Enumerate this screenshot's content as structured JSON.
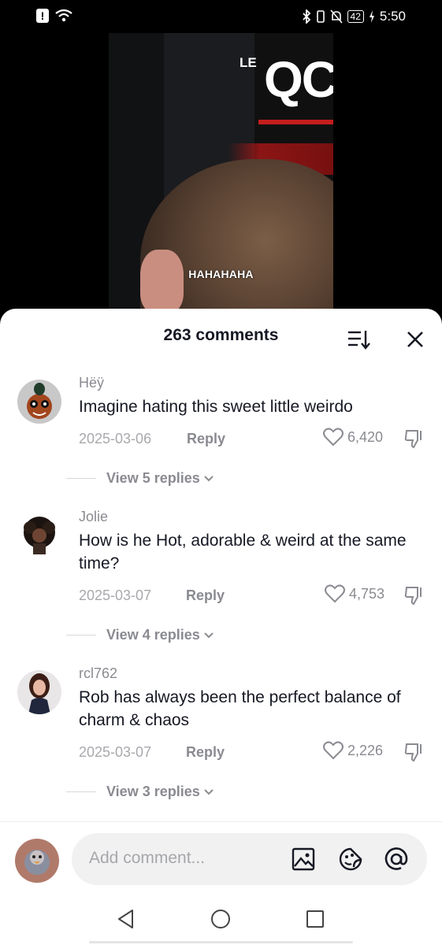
{
  "status_bar": {
    "alert_icon": "!",
    "battery_level": "42",
    "time": "5:50"
  },
  "video": {
    "caption": "HAHAHAHA",
    "sign_text_small": "LE",
    "sign_text_large": "QC"
  },
  "comments_sheet": {
    "title": "263 comments",
    "comments": [
      {
        "username": "Hëÿ",
        "text": "Imagine hating this sweet little weirdo",
        "date": "2025-03-06",
        "reply_label": "Reply",
        "likes": "6,420",
        "view_replies": "View 5 replies"
      },
      {
        "username": "Jolie",
        "text": "How is he Hot, adorable & weird at the same time?",
        "date": "2025-03-07",
        "reply_label": "Reply",
        "likes": "4,753",
        "view_replies": "View 4 replies"
      },
      {
        "username": "rcl762",
        "text": "Rob has always been the perfect balance of charm & chaos",
        "date": "2025-03-07",
        "reply_label": "Reply",
        "likes": "2,226",
        "view_replies": "View 3 replies"
      }
    ]
  },
  "comment_input": {
    "placeholder": "Add comment..."
  },
  "icons": {
    "sort": "sort-icon",
    "close": "close-icon",
    "heart": "heart-icon",
    "dislike": "thumbs-down-icon",
    "image": "image-icon",
    "emoji": "emoji-icon",
    "mention": "at-mention-icon",
    "back": "back-triangle-icon",
    "home": "home-circle-icon",
    "recents": "recents-square-icon"
  }
}
